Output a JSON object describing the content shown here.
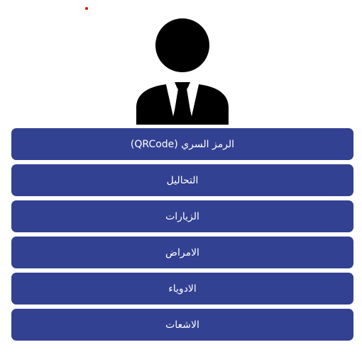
{
  "colors": {
    "button_bg": "#334192",
    "button_text": "#ffffff",
    "avatar": "#000000",
    "indicator": "#e60000"
  },
  "avatar": {
    "icon": "businessman-icon"
  },
  "menu": {
    "items": [
      {
        "label": "الرمز السري (QRCode)"
      },
      {
        "label": "التحاليل"
      },
      {
        "label": "الزيارات"
      },
      {
        "label": "الامراض"
      },
      {
        "label": "الادوياء"
      },
      {
        "label": "الاشعات"
      }
    ]
  }
}
